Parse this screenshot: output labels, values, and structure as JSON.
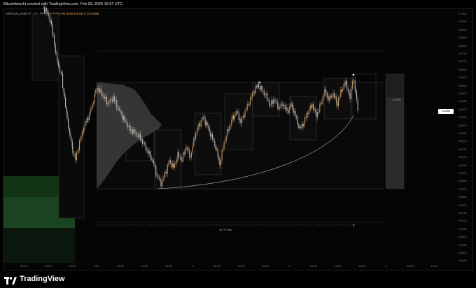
{
  "header": {
    "caption": "Bitcoinkimchi created with TradingView.com, Feb 03, 2026 16:57 UTC"
  },
  "legend": {
    "symbol": "VIRTUALUSDT.P",
    "interval": "10",
    "exchange": "Bybit",
    "ohlc": "O0.6389 H0.6406 L0.6372 C0.6396"
  },
  "price_axis": {
    "labels": [
      "0.7000",
      "0.6950",
      "0.6900",
      "0.6850",
      "0.6800",
      "0.6750",
      "0.6700",
      "0.6650",
      "0.6600",
      "0.6550",
      "0.6500",
      "0.6450",
      "0.6400",
      "0.6350",
      "0.6300",
      "0.6250",
      "0.6200",
      "0.6150",
      "0.6100",
      "0.6050",
      "0.6000",
      "0.5950",
      "0.5900",
      "0.5850",
      "0.5800",
      "0.5750",
      "0.5700",
      "0.5650",
      "0.5600",
      "0.5550",
      "0.5500",
      "0.5450"
    ],
    "current_price": "0.6396",
    "range_label": "4.22 %"
  },
  "time_axis": {
    "labels": [
      "06:00",
      "12:00",
      "18:00",
      "Feb",
      "06:00",
      "12:00",
      "18:00",
      "2",
      "06:00",
      "12:00",
      "18:00",
      "3",
      "06:00",
      "12:00",
      "18:00",
      "4",
      "06:00",
      "12:00"
    ]
  },
  "annotations": {
    "measure_label": "26 7% 35m"
  },
  "colors": {
    "background": "#000000",
    "candle_up": "#d7a36a",
    "candle_down": "#c8c8c8",
    "profile": "#5c5c5c",
    "green_zone": "#163c1b",
    "box": "#3d3d3d"
  },
  "footer": {
    "logo_text": "TradingView",
    "logo_icon": "tradingview-logo-icon"
  }
}
